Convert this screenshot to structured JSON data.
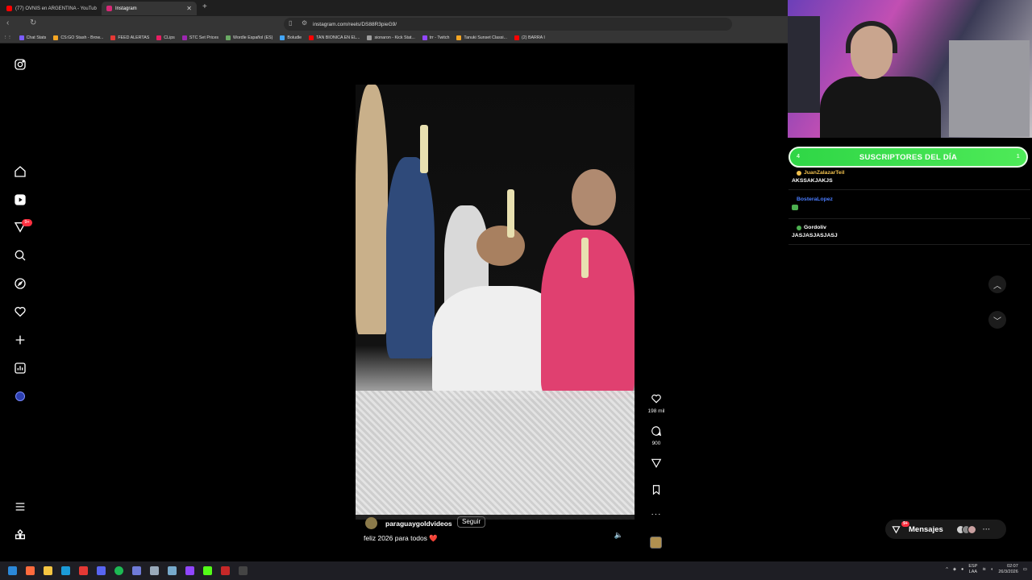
{
  "browser": {
    "tabs": [
      {
        "label": "(77) OVNIS en ARGENTINA - YouTub",
        "active": false,
        "favicon_color": "#ff0000"
      },
      {
        "label": "Instagram",
        "active": true,
        "favicon_color": "#d62976"
      }
    ],
    "url": "instagram.com/reels/DS88R3pieG9/",
    "bookmarks": [
      {
        "label": "Chat Stats",
        "color": "#7b5cff"
      },
      {
        "label": "CS:GO Stash - Brow...",
        "color": "#f5a623"
      },
      {
        "label": "FEED ALERTAS",
        "color": "#e53935"
      },
      {
        "label": "CLips",
        "color": "#e91e63"
      },
      {
        "label": "STC Set Prices",
        "color": "#9c27b0"
      },
      {
        "label": "Wordle Español (ES)",
        "color": "#6aaa64"
      },
      {
        "label": "Boludle",
        "color": "#42a5f5"
      },
      {
        "label": "TAN BIONICA EN EL...",
        "color": "#ff0000"
      },
      {
        "label": "sionaron - Kick Stat...",
        "color": "#9e9e9e"
      },
      {
        "label": "trr - Twitch",
        "color": "#9146ff"
      },
      {
        "label": "Tanuki Sunset Classi...",
        "color": "#f5a623"
      },
      {
        "label": "(2) BARRA I",
        "color": "#ff0000"
      }
    ]
  },
  "sidebar": {
    "items": [
      "instagram-logo",
      "home",
      "reels",
      "messages",
      "search",
      "explore",
      "notifications",
      "create",
      "dashboard",
      "profile"
    ],
    "notification_badge": "9+"
  },
  "reel": {
    "username": "paraguaygoldvideos",
    "follow_label": "Seguir",
    "caption": "feliz 2026 para todos ❤️",
    "likes": "198 mil",
    "comments": "900"
  },
  "stream": {
    "sub_banner": "SUSCRIPTORES DEL DÍA",
    "sub_left": "4",
    "sub_right": "1",
    "chat": [
      {
        "user": "JuanZalazarTeil",
        "user_color": "#f2c14e",
        "message": "AKSSAKJAKJS"
      },
      {
        "user": "BosteraLopez",
        "user_color": "#4a7cff",
        "message": ""
      },
      {
        "user": "Gordoliv",
        "user_color": "#ffffff",
        "message": "JASJASJASJASJ"
      }
    ]
  },
  "messages": {
    "label": "Mensajes",
    "badge": "9+"
  },
  "taskbar": {
    "lang": "ESP",
    "lang_sub": "LAA",
    "time": "02:07",
    "date": "26/3/2026"
  }
}
